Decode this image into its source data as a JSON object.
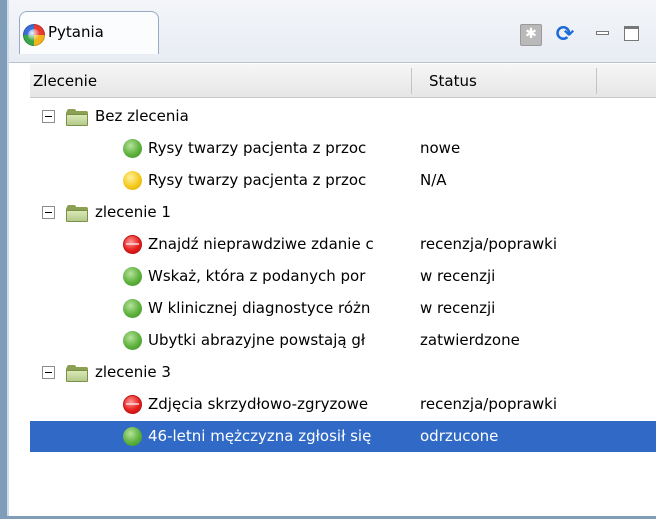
{
  "view": {
    "tab_title": "Pytania",
    "tab_icon": "colorful-sphere-icon",
    "toolbar": {
      "collapse_icon": "collapse-all-icon",
      "refresh_icon": "refresh-icon",
      "minimize_icon": "minimize-icon",
      "maximize_icon": "maximize-icon"
    }
  },
  "table": {
    "columns": [
      "Zlecenie",
      "Status"
    ],
    "rows": [
      {
        "kind": "group",
        "label": "Bez zlecenia"
      },
      {
        "kind": "item",
        "status_color": "green",
        "text": "Rysy twarzy pacjenta z przoc",
        "status": "nowe"
      },
      {
        "kind": "item",
        "status_color": "yellow",
        "text": "Rysy twarzy pacjenta z przoc",
        "status": "N/A"
      },
      {
        "kind": "group",
        "label": "zlecenie 1"
      },
      {
        "kind": "item",
        "status_color": "red",
        "text": "Znajdź nieprawdziwe zdanie c",
        "status": "recenzja/poprawki"
      },
      {
        "kind": "item",
        "status_color": "green",
        "text": "Wskaż, która z podanych por",
        "status": "w recenzji"
      },
      {
        "kind": "item",
        "status_color": "green",
        "text": "W klinicznej diagnostyce różn",
        "status": "w recenzji"
      },
      {
        "kind": "item",
        "status_color": "green",
        "text": "Ubytki abrazyjne powstają gł",
        "status": "zatwierdzone"
      },
      {
        "kind": "group",
        "label": "zlecenie 3"
      },
      {
        "kind": "item",
        "status_color": "red",
        "text": "Zdjęcia skrzydłowo-zgryzowe",
        "status": "recenzja/poprawki"
      },
      {
        "kind": "item",
        "status_color": "green",
        "text": "46-letni mężczyzna zgłosił się",
        "status": "odrzucone",
        "selected": true
      }
    ]
  },
  "colors": {
    "selection": "#3169c6",
    "header_bg": "#ecedf0",
    "frame_edge": "#7f9db9"
  }
}
